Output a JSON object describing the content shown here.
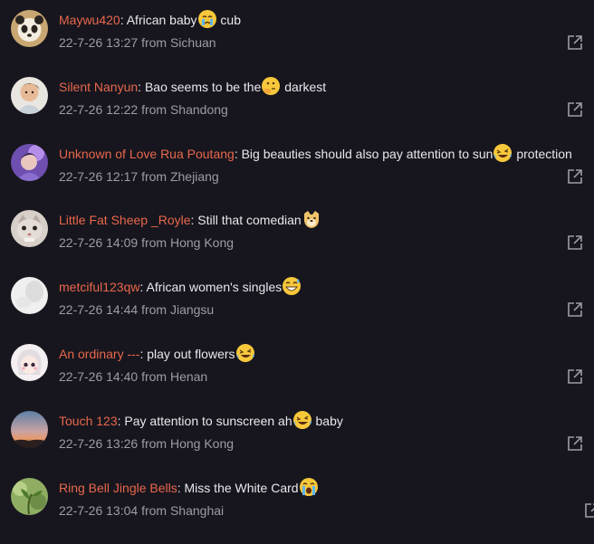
{
  "colors": {
    "background": "#17161e",
    "username": "#e8674c",
    "text": "#e8e8ec",
    "meta": "#9d9ca6"
  },
  "comments": [
    {
      "user": "Maywu420",
      "text_before": ": African baby",
      "emoji": "crying-face-emoji",
      "text_after": " cub",
      "date": "22-7-26 13:27",
      "location": "from Sichuan",
      "avatar": "panda-avatar"
    },
    {
      "user": "Silent Nanyun",
      "text_before": ": Bao seems to be the",
      "emoji": "thinking-face-emoji",
      "text_after": " darkest",
      "date": "22-7-26 12:22",
      "location": "from Shandong",
      "avatar": "child-photo-avatar"
    },
    {
      "user": "Unknown of Love Rua Poutang",
      "text_before": ": Big beauties should also pay attention to sun",
      "emoji": "laughing-crying-face-emoji",
      "text_after": " protection",
      "date": "22-7-26 12:17",
      "location": "from Zhejiang",
      "avatar": "purple-anime-avatar"
    },
    {
      "user": "Little Fat Sheep _Royle",
      "text_before": ": Still that comedian",
      "emoji": "doge-emoji",
      "text_after": "",
      "date": "22-7-26 14:09",
      "location": "from Hong Kong",
      "avatar": "cat-avatar"
    },
    {
      "user": "metciful123qw",
      "text_before": ": African women's singles",
      "emoji": "grinning-sweat-emoji",
      "text_after": "",
      "date": "22-7-26 14:44",
      "location": "from Jiangsu",
      "avatar": "white-blur-avatar"
    },
    {
      "user": "An ordinary ---",
      "text_before": ": play out flowers",
      "emoji": "laughing-crying-face-emoji",
      "text_after": "",
      "date": "22-7-26 14:40",
      "location": "from Henan",
      "avatar": "cartoon-girl-avatar"
    },
    {
      "user": "Touch 123",
      "text_before": ": Pay attention to sunscreen ah",
      "emoji": "laughing-crying-face-emoji",
      "text_after": " baby",
      "date": "22-7-26 13:26",
      "location": "from Hong Kong",
      "avatar": "sunset-avatar"
    },
    {
      "user": "Ring Bell Jingle Bells",
      "text_before": ": Miss the White Card",
      "emoji": "loudly-crying-face-emoji",
      "text_after": "",
      "date": "22-7-26 13:04",
      "location": "from Shanghai",
      "avatar": "green-plant-avatar"
    }
  ]
}
